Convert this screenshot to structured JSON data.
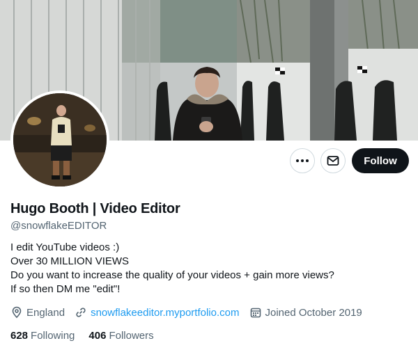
{
  "profile": {
    "name": "Hugo Booth | Video Editor",
    "handle": "@snowflakeEDITOR",
    "bio": [
      "I edit YouTube videos :)",
      "Over 30 MILLION VIEWS",
      "Do you want to increase the quality of your videos + gain more views?",
      "If so then DM me \"edit\"!"
    ],
    "location": "England",
    "website": "snowflakeeditor.myportfolio.com",
    "joined": "Joined October 2019"
  },
  "stats": {
    "following_count": "628",
    "following_label": "Following",
    "followers_count": "406",
    "followers_label": "Followers"
  },
  "actions": {
    "follow_label": "Follow"
  },
  "icons": {
    "more": "more-horizontal-icon",
    "message": "envelope-icon",
    "location": "location-pin-icon",
    "link": "link-icon",
    "calendar": "calendar-icon"
  },
  "colors": {
    "primary_text": "#0f1419",
    "secondary_text": "#536471",
    "link": "#1d9bf0",
    "follow_button": "#0f1419",
    "border": "#cfd9de"
  }
}
